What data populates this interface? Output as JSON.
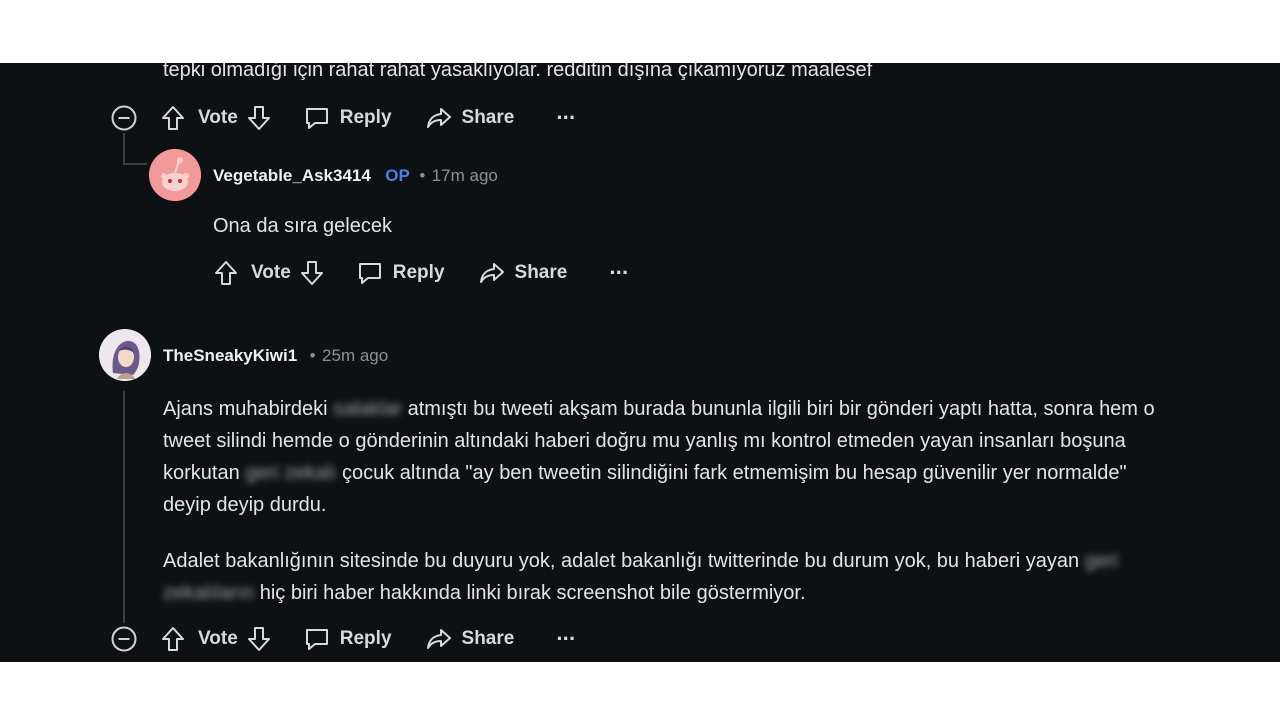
{
  "actions": {
    "vote": "Vote",
    "reply": "Reply",
    "share": "Share",
    "more": "···"
  },
  "comment_top": {
    "text_tail": "tepki olmadığı için rahat rahat yasaklıyolar. redditin dışına çıkamıyoruz maalesef"
  },
  "comment_reply": {
    "username": "Vegetable_Ask3414",
    "op_badge": "OP",
    "separator": "•",
    "time": "17m ago",
    "body": "Ona da sıra gelecek"
  },
  "comment_second": {
    "username": "TheSneakyKiwi1",
    "separator": "•",
    "time": "25m ago",
    "p1_l1_a": "Ajans muhabirdeki",
    "p1_l1_blur": "salaklar",
    "p1_l1_b": "atmıştı bu tweeti akşam burada bununla ilgili biri bir gönderi yaptı hatta, sonra hem o",
    "p1_l2": "tweet silindi hemde o gönderinin altındaki haberi doğru mu yanlış mı kontrol etmeden yayan insanları boşuna",
    "p1_l3_a": "korkutan",
    "p1_l3_blur": "geri zekalı",
    "p1_l3_b": "çocuk altında \"ay ben tweetin silindiğini fark etmemişim bu hesap güvenilir yer normalde\"",
    "p1_l4": "deyip deyip durdu.",
    "p2_l1_a": "Adalet bakanlığının sitesinde bu duyuru yok, adalet bakanlığı twitterinde bu durum yok, bu haberi yayan",
    "p2_l1_blur": "geri",
    "p2_l2_blur": "zekalıların",
    "p2_l2_b": "hiç biri haber hakkında linki bırak screenshot bile göstermiyor."
  },
  "icons": {
    "collapse": "collapse-icon",
    "upvote": "upvote-icon",
    "downvote": "downvote-icon",
    "reply": "reply-icon",
    "share": "share-icon",
    "more": "more-icon"
  }
}
